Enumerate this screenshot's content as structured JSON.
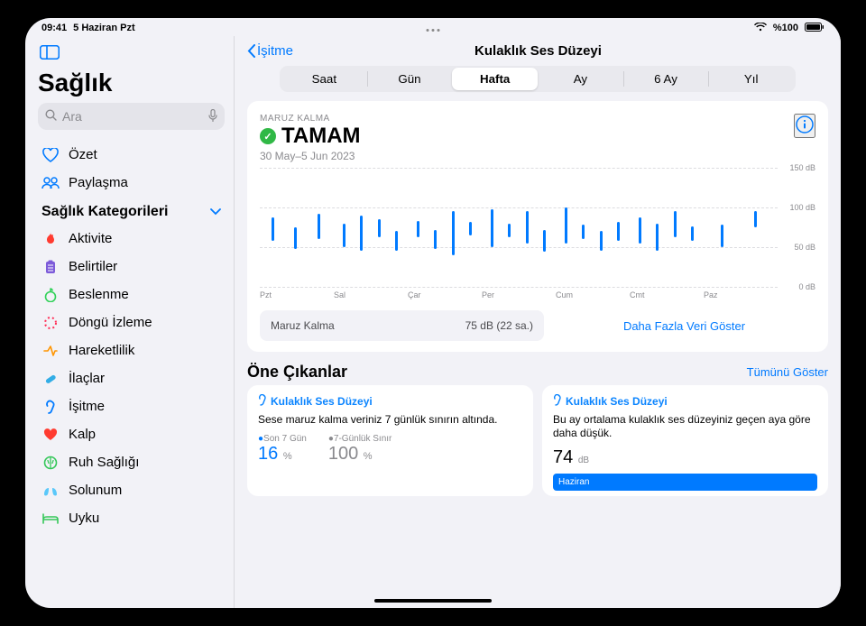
{
  "statusbar": {
    "time": "09:41",
    "date": "5 Haziran Pzt",
    "battery": "%100"
  },
  "sidebar": {
    "app_title": "Sağlık",
    "search_placeholder": "Ara",
    "summary": "Özet",
    "sharing": "Paylaşma",
    "categories_header": "Sağlık Kategorileri",
    "categories": [
      {
        "label": "Aktivite",
        "icon": "flame-icon",
        "color": "c-orange"
      },
      {
        "label": "Belirtiler",
        "icon": "clipboard-icon",
        "color": "c-purple"
      },
      {
        "label": "Beslenme",
        "icon": "apple-icon",
        "color": "c-green"
      },
      {
        "label": "Döngü İzleme",
        "icon": "cycle-icon",
        "color": "c-pink"
      },
      {
        "label": "Hareketlilik",
        "icon": "mobility-icon",
        "color": "c-yellow"
      },
      {
        "label": "İlaçlar",
        "icon": "pill-icon",
        "color": "c-teal"
      },
      {
        "label": "İşitme",
        "icon": "ear-icon",
        "color": "c-blue"
      },
      {
        "label": "Kalp",
        "icon": "heart-icon",
        "color": "c-red"
      },
      {
        "label": "Ruh Sağlığı",
        "icon": "brain-icon",
        "color": "c-mint"
      },
      {
        "label": "Solunum",
        "icon": "lungs-icon",
        "color": "c-cyan"
      },
      {
        "label": "Uyku",
        "icon": "bed-icon",
        "color": "c-mint"
      }
    ]
  },
  "nav": {
    "back": "İşitme",
    "title": "Kulaklık Ses Düzeyi"
  },
  "segments": [
    "Saat",
    "Gün",
    "Hafta",
    "Ay",
    "6 Ay",
    "Yıl"
  ],
  "segment_selected": 2,
  "exposure": {
    "label": "MARUZ KALMA",
    "status": "TAMAM",
    "date_range": "30 May–5 Jun 2023",
    "summary_label": "Maruz Kalma",
    "summary_value": "75 dB (22 sa.)",
    "more_data": "Daha Fazla Veri Göster"
  },
  "highlights": {
    "title": "Öne Çıkanlar",
    "show_all": "Tümünü Göster",
    "cards": [
      {
        "title": "Kulaklık Ses Düzeyi",
        "body": "Sese maruz kalma veriniz 7 günlük sınırın altında.",
        "stat1_label": "Son 7 Gün",
        "stat1_value": "16",
        "stat1_unit": "%",
        "stat2_label": "7-Günlük Sınır",
        "stat2_value": "100",
        "stat2_unit": "%"
      },
      {
        "title": "Kulaklık Ses Düzeyi",
        "body": "Bu ay ortalama kulaklık ses düzeyiniz geçen aya göre daha düşük.",
        "value": "74",
        "unit": "dB",
        "bar_label": "Haziran"
      }
    ]
  },
  "chart_data": {
    "type": "range-bar",
    "title": "Kulaklık Ses Düzeyi – Hafta",
    "ylabel": "dB",
    "ylim": [
      0,
      150
    ],
    "yticks": [
      0,
      50,
      100,
      150
    ],
    "xticks": [
      "Pzt",
      "Sal",
      "Çar",
      "Per",
      "Cum",
      "Cmt",
      "Paz"
    ],
    "series": [
      {
        "day": 0,
        "ranges": [
          [
            58,
            88
          ],
          [
            48,
            75
          ],
          [
            60,
            92
          ]
        ]
      },
      {
        "day": 1,
        "ranges": [
          [
            50,
            80
          ],
          [
            45,
            90
          ],
          [
            62,
            85
          ],
          [
            45,
            70
          ]
        ]
      },
      {
        "day": 2,
        "ranges": [
          [
            62,
            83
          ],
          [
            48,
            72
          ],
          [
            40,
            95
          ],
          [
            65,
            82
          ]
        ]
      },
      {
        "day": 3,
        "ranges": [
          [
            50,
            98
          ],
          [
            62,
            80
          ],
          [
            55,
            95
          ],
          [
            44,
            72
          ]
        ]
      },
      {
        "day": 4,
        "ranges": [
          [
            55,
            100
          ],
          [
            60,
            78
          ],
          [
            46,
            70
          ],
          [
            58,
            82
          ]
        ]
      },
      {
        "day": 5,
        "ranges": [
          [
            55,
            88
          ],
          [
            46,
            80
          ],
          [
            62,
            95
          ],
          [
            58,
            76
          ]
        ]
      },
      {
        "day": 6,
        "ranges": [
          [
            50,
            78
          ],
          [
            75,
            96
          ]
        ]
      }
    ]
  }
}
